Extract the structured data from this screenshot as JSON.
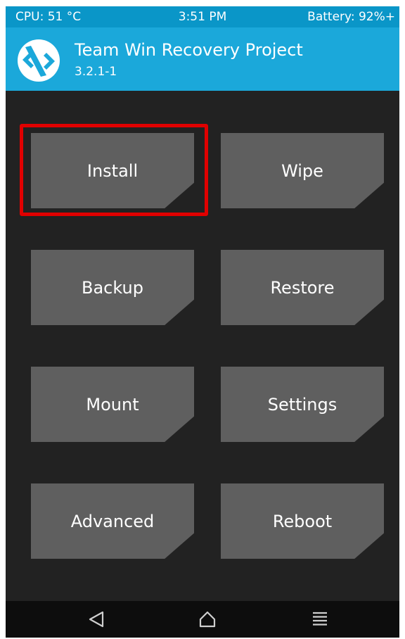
{
  "status_bar": {
    "cpu": "CPU: 51 °C",
    "time": "3:51 PM",
    "battery": "Battery: 92%+"
  },
  "header": {
    "title": "Team Win Recovery Project",
    "version": "3.2.1-1",
    "logo_icon": "twrp-logo-icon"
  },
  "main": {
    "buttons": [
      {
        "label": "Install"
      },
      {
        "label": "Wipe"
      },
      {
        "label": "Backup"
      },
      {
        "label": "Restore"
      },
      {
        "label": "Mount"
      },
      {
        "label": "Settings"
      },
      {
        "label": "Advanced"
      },
      {
        "label": "Reboot"
      }
    ],
    "highlight_color": "#e00000"
  },
  "nav_bar": {
    "icons": [
      "back-icon",
      "home-icon",
      "menu-icon"
    ]
  },
  "colors": {
    "status_bar": "#0a96c8",
    "title_bar": "#1ba8da",
    "background": "#222222",
    "button": "#5f5f5f"
  }
}
